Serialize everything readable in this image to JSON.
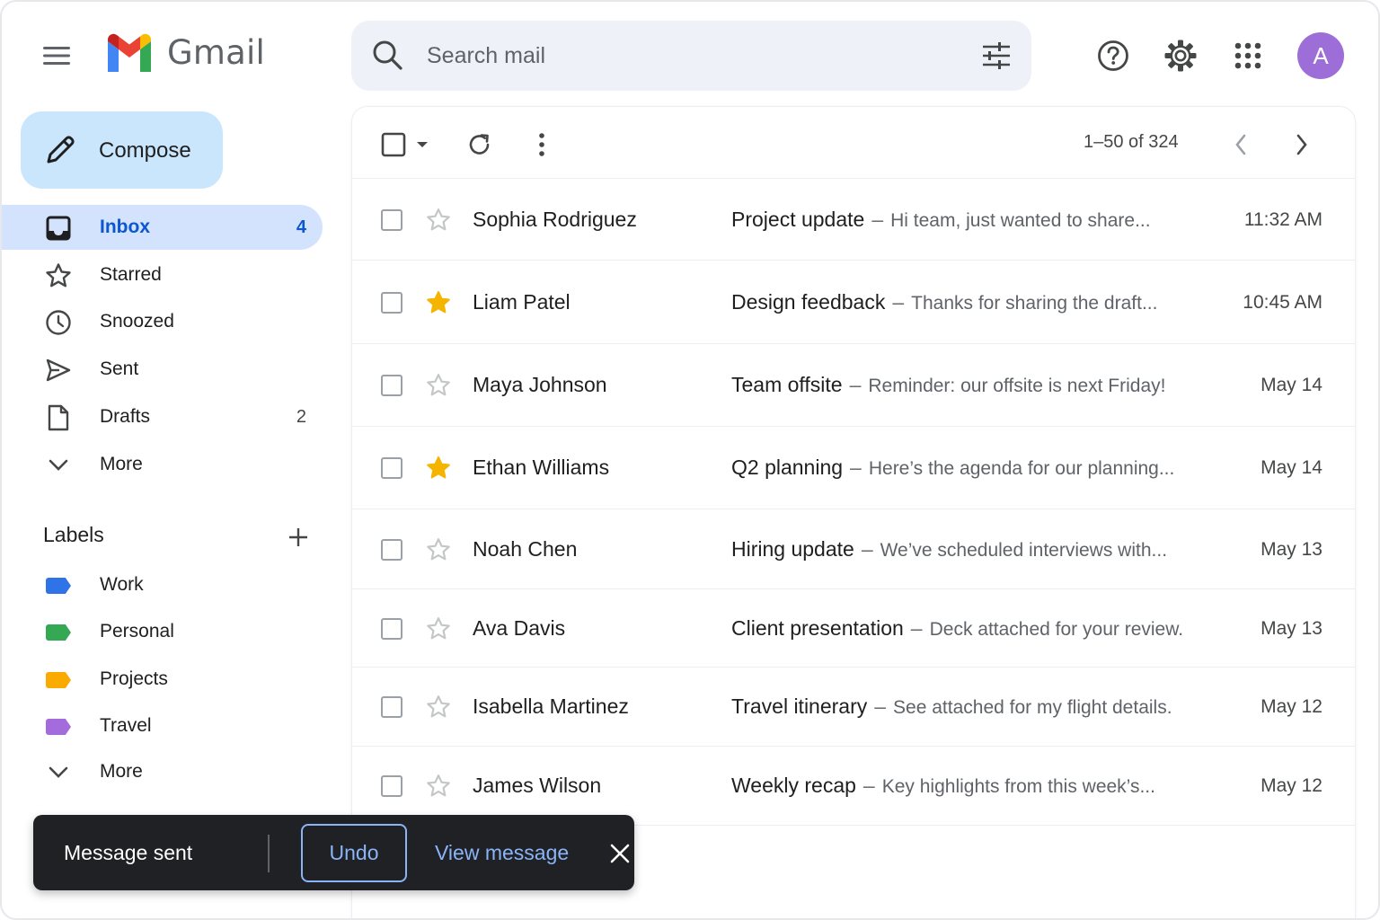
{
  "header": {
    "app_name": "Gmail",
    "search_placeholder": "Search mail",
    "avatar_initial": "A",
    "avatar_color": "#9d6ed8",
    "icons": [
      "menu-icon",
      "gmail-logo",
      "search-icon",
      "tune-icon",
      "help-icon",
      "gear-icon",
      "apps-icon"
    ]
  },
  "sidebar": {
    "compose_label": "Compose",
    "items": [
      {
        "label": "Inbox",
        "count": "4",
        "icon": "inbox-icon",
        "active": true
      },
      {
        "label": "Starred",
        "count": "",
        "icon": "star-icon"
      },
      {
        "label": "Snoozed",
        "count": "",
        "icon": "clock-icon"
      },
      {
        "label": "Sent",
        "count": "",
        "icon": "send-icon"
      },
      {
        "label": "Drafts",
        "count": "2",
        "icon": "draft-icon"
      },
      {
        "label": "More",
        "count": "",
        "icon": "chevron-down-icon"
      }
    ],
    "labels_heading": "Labels",
    "labels": [
      {
        "label": "Work",
        "color": "#2f73e8"
      },
      {
        "label": "Personal",
        "color": "#34a853"
      },
      {
        "label": "Projects",
        "color": "#f9ab00"
      },
      {
        "label": "Travel",
        "color": "#a36bdc"
      }
    ],
    "labels_more": "More"
  },
  "toolbar": {
    "page_info": "1–50 of 324"
  },
  "emails": [
    {
      "sender": "Sophia Rodriguez",
      "subject": "Project update",
      "snippet": "Hi team, just wanted to share...",
      "time": "11:32 AM",
      "starred": false
    },
    {
      "sender": "Liam Patel",
      "subject": "Design feedback",
      "snippet": "Thanks for sharing the draft...",
      "time": "10:45 AM",
      "starred": true
    },
    {
      "sender": "Maya Johnson",
      "subject": "Team offsite",
      "snippet": "Reminder: our offsite is next Friday!",
      "time": "May 14",
      "starred": false
    },
    {
      "sender": "Ethan Williams",
      "subject": "Q2 planning",
      "snippet": "Here’s the agenda for our planning...",
      "time": "May 14",
      "starred": true
    },
    {
      "sender": "Noah Chen",
      "subject": "Hiring update",
      "snippet": "We’ve scheduled interviews with...",
      "time": "May 13",
      "starred": false
    },
    {
      "sender": "Ava Davis",
      "subject": "Client presentation",
      "snippet": "Deck attached for your review.",
      "time": "May 13",
      "starred": false
    },
    {
      "sender": "Isabella Martinez",
      "subject": "Travel itinerary",
      "snippet": "See attached for my flight details.",
      "time": "May 12",
      "starred": false
    },
    {
      "sender": "James Wilson",
      "subject": "Weekly recap",
      "snippet": "Key highlights from this week’s...",
      "time": "May 12",
      "starred": false
    }
  ],
  "snackbar": {
    "message": "Message sent",
    "undo_label": "Undo",
    "view_label": "View message"
  },
  "colors": {
    "star_on": "#f4b400",
    "star_off": "#c4c7c5",
    "accent": "#0b57d0"
  }
}
